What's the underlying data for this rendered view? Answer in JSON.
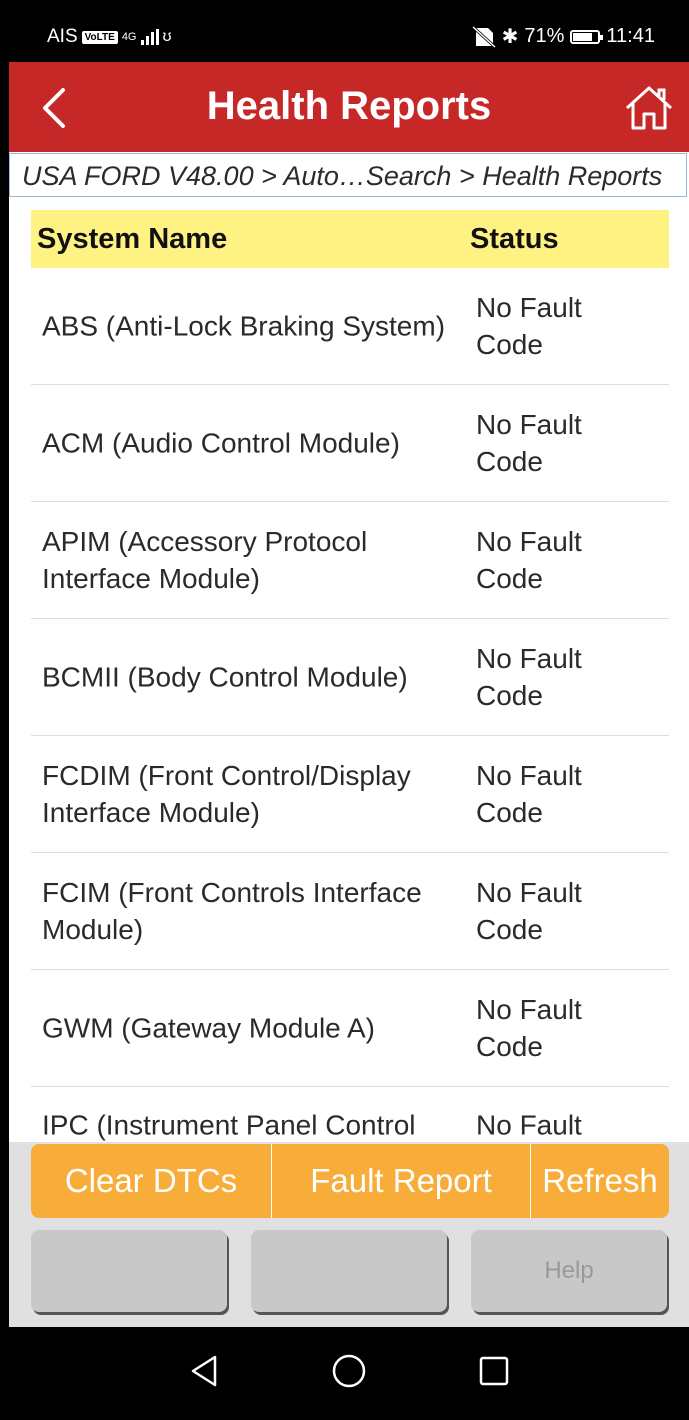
{
  "status_bar": {
    "carrier": "AIS",
    "volte": "VoLTE",
    "network": "4G",
    "battery": "71%",
    "time": "11:41"
  },
  "header": {
    "title": "Health Reports"
  },
  "breadcrumb": "USA FORD V48.00 > Auto…Search > Health Reports",
  "table": {
    "col_name": "System Name",
    "col_status": "Status",
    "rows": [
      {
        "name": "ABS (Anti-Lock Braking System)",
        "status": "No Fault Code"
      },
      {
        "name": "ACM (Audio Control Module)",
        "status": "No Fault Code"
      },
      {
        "name": "APIM (Accessory Protocol Interface Module)",
        "status": "No Fault Code"
      },
      {
        "name": "BCMII (Body Control Module)",
        "status": "No Fault Code"
      },
      {
        "name": "FCDIM (Front Control/Display Interface Module)",
        "status": "No Fault Code"
      },
      {
        "name": "FCIM (Front Controls Interface Module)",
        "status": "No Fault Code"
      },
      {
        "name": "GWM (Gateway Module A)",
        "status": "No Fault Code"
      },
      {
        "name": "IPC (Instrument Panel Control",
        "status": "No Fault"
      }
    ]
  },
  "actions": {
    "clear": "Clear DTCs",
    "fault_report": "Fault Report",
    "refresh": "Refresh"
  },
  "buttons": {
    "help": "Help"
  },
  "colors": {
    "header_bg": "#c62828",
    "table_header_bg": "#fdf282",
    "action_bg": "#f8ad3b"
  }
}
